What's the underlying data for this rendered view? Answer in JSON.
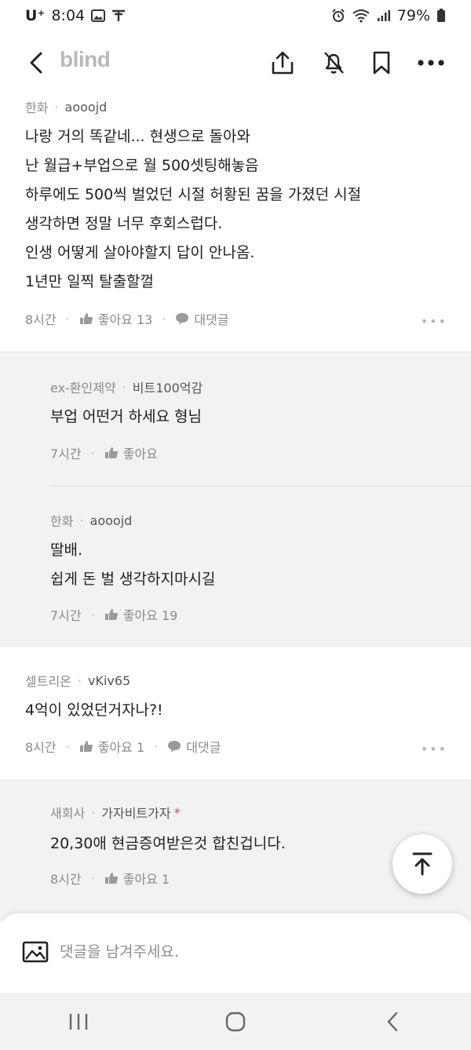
{
  "status": {
    "carrier": "U⁺",
    "time": "8:04",
    "battery": "79%"
  },
  "header": {
    "logo": "blind",
    "icons": [
      "back-icon",
      "share-icon",
      "notification-off-icon",
      "bookmark-icon",
      "more-icon"
    ]
  },
  "comments": [
    {
      "company": "한화",
      "nickname": "aooojd",
      "lines": [
        "나랑 거의 똑같네... 현생으로 돌아와",
        "난 월급+부업으로 월 500셋팅해놓음",
        "하루에도 500씩 벌었던 시절 허황된 꿈을 가졌던 시절",
        "생각하면 정말 너무 후회스럽다.",
        "인생 어떻게 살아야할지 답이 안나옴.",
        "1년만 일찍 탈출할껄"
      ],
      "time": "8시간",
      "likes": "좋아요 13",
      "reply_label": "대댓글"
    },
    {
      "company": "셀트리온",
      "nickname": "vKiv65",
      "lines": [
        "4억이 있었던거자나?!"
      ],
      "time": "8시간",
      "likes": "좋아요 1",
      "reply_label": "대댓글"
    }
  ],
  "replies": [
    {
      "company": "ex-환인제약",
      "nickname": "비트100억감",
      "lines": [
        "부업 어떤거 하세요 형님"
      ],
      "time": "7시간",
      "likes": "좋아요"
    },
    {
      "company": "한화",
      "nickname": "aooojd",
      "lines": [
        "딸배.",
        "쉽게 돈 벌 생각하지마시길"
      ],
      "time": "7시간",
      "likes": "좋아요 19"
    },
    {
      "company": "새회사",
      "nickname": "가자비트가자",
      "author_mark": "*",
      "lines": [
        "20,30애 현금증여받은것 합친겁니다."
      ],
      "time": "8시간",
      "likes": "좋아요 1"
    }
  ],
  "input": {
    "placeholder": "댓글을 남겨주세요."
  },
  "colors": {
    "reply_bg": "#f2f2f3",
    "logo": "#b9b9b9",
    "author_mark": "#e0443a"
  }
}
